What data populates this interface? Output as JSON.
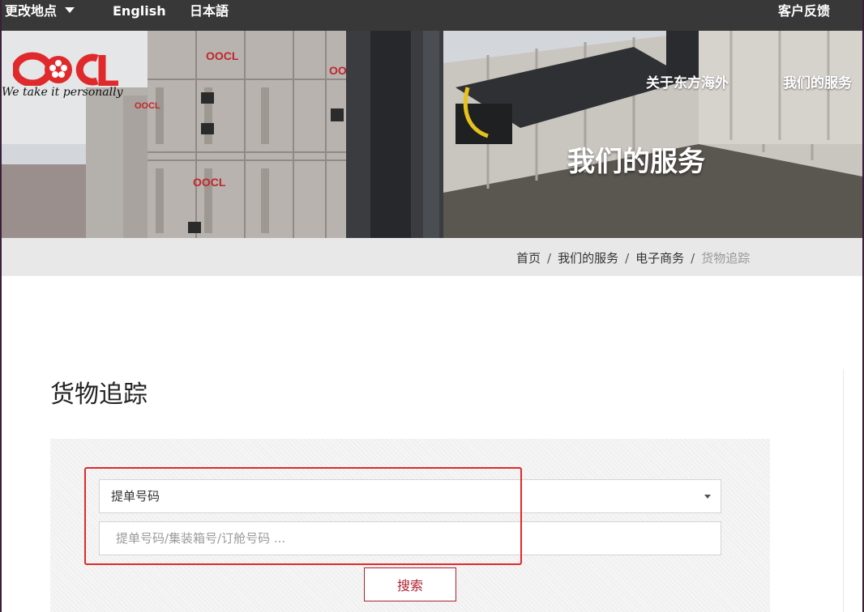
{
  "topbar": {
    "location_label": "更改地点",
    "english_label": "English",
    "japanese_label": "日本語",
    "feedback_label": "客户反馈"
  },
  "brand": {
    "logo_text": "OOCL",
    "slogan": "We take it personally",
    "logo_color": "#e0292b"
  },
  "hero": {
    "nav": {
      "about_label": "关于东方海外",
      "services_label": "我们的服务"
    },
    "title": "我们的服务"
  },
  "breadcrumb": {
    "items": [
      "首页",
      "我们的服务",
      "电子商务"
    ],
    "current": "货物追踪",
    "separator": "/"
  },
  "main": {
    "title": "货物追踪",
    "search_type": {
      "selected": "提单号码"
    },
    "search_input": {
      "value": "",
      "placeholder": "提单号码/集装箱号/订舱号码 ..."
    },
    "search_button_label": "搜索"
  },
  "colors": {
    "topbar_bg": "#383838",
    "accent_red": "#b02030",
    "highlight_red": "#e0292b",
    "breadcrumb_bg": "#e8e8e8"
  }
}
